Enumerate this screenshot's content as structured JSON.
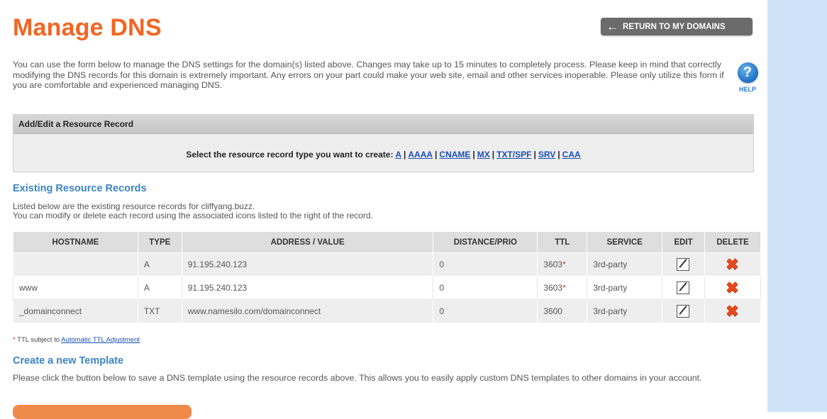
{
  "title": "Manage DNS",
  "return_button": "RETURN TO MY DOMAINS",
  "intro": "You can use the form below to manage the DNS settings for the domain(s) listed above. Changes may take up to 15 minutes to completely process. Please keep in mind that correctly modifying the DNS records for this domain is extremely important. Any errors on your part could make your web site, email and other services inoperable. Please only utilize this form if you are comfortable and experienced managing DNS.",
  "help_label": "HELP",
  "add_edit": {
    "header": "Add/Edit a Resource Record",
    "prompt": "Select the resource record type you want to create:",
    "types": [
      "A",
      "AAAA",
      "CNAME",
      "MX",
      "TXT/SPF",
      "SRV",
      "CAA"
    ]
  },
  "existing": {
    "title": "Existing Resource Records",
    "desc_line1": "Listed below are the existing resource records for cliffyang.buzz.",
    "desc_line2": "You can modify or delete each record using the associated icons listed to the right of the record.",
    "columns": [
      "HOSTNAME",
      "TYPE",
      "ADDRESS / VALUE",
      "DISTANCE/PRIO",
      "TTL",
      "SERVICE",
      "EDIT",
      "DELETE"
    ],
    "rows": [
      {
        "hostname": "",
        "type": "A",
        "value": "91.195.240.123",
        "prio": "0",
        "ttl": "3603",
        "ttl_flag": "*",
        "service": "3rd-party"
      },
      {
        "hostname": "www",
        "type": "A",
        "value": "91.195.240.123",
        "prio": "0",
        "ttl": "3603",
        "ttl_flag": "*",
        "service": "3rd-party"
      },
      {
        "hostname": "_domainconnect",
        "type": "TXT",
        "value": "www.namesilo.com/domainconnect",
        "prio": "0",
        "ttl": "3600",
        "ttl_flag": "",
        "service": "3rd-party"
      }
    ]
  },
  "ttl_note": {
    "asterisk": "*",
    "text": " TTL subject to ",
    "link": "Automatic TTL Adjustment"
  },
  "template": {
    "title": "Create a new Template",
    "desc": "Please click the button below to save a DNS template using the resource records above. This allows you to easily apply custom DNS templates to other domains in your account."
  },
  "colors": {
    "title": "#f26522",
    "section_title": "#3b84c4",
    "link": "#1a4fb5",
    "delete_icon": "#e8481b",
    "side_panel": "#cfe3f8"
  },
  "icons": {
    "return": "left-arrow-icon",
    "help": "question-icon",
    "edit": "edit-pencil-icon",
    "delete": "delete-x-icon"
  }
}
